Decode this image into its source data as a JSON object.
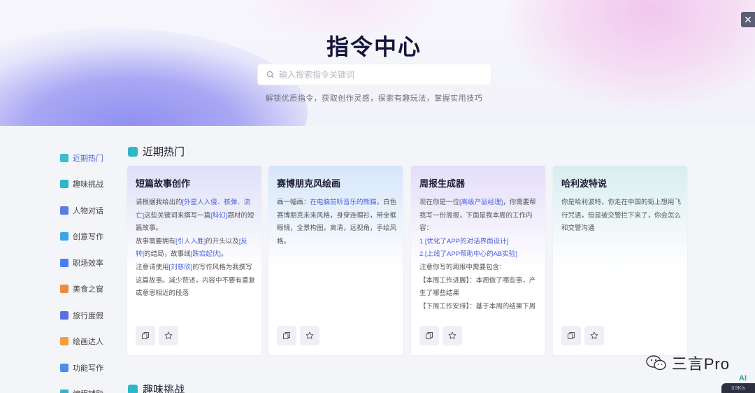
{
  "hero": {
    "title": "指令中心",
    "search_placeholder": "输入搜索指令关键词",
    "subtitle": "解锁优质指令，获取创作灵感，探索有趣玩法，掌握实用技巧",
    "close_label": "✕"
  },
  "sidebar": {
    "items": [
      {
        "label": "近期热门",
        "icon": "fire-icon",
        "color": "#3bbfd0",
        "active": true
      },
      {
        "label": "趣味挑战",
        "icon": "trophy-icon",
        "color": "#2fb6c9"
      },
      {
        "label": "人物对话",
        "icon": "person-icon",
        "color": "#5b7be6"
      },
      {
        "label": "创意写作",
        "icon": "pen-icon",
        "color": "#3aa6e8"
      },
      {
        "label": "职场效率",
        "icon": "send-icon",
        "color": "#4a7ef0"
      },
      {
        "label": "美食之窗",
        "icon": "food-icon",
        "color": "#f08a3a"
      },
      {
        "label": "旅行度假",
        "icon": "camera-icon",
        "color": "#5b6fe0"
      },
      {
        "label": "绘画达人",
        "icon": "palette-icon",
        "color": "#f0a040"
      },
      {
        "label": "功能写作",
        "icon": "doc-icon",
        "color": "#4a90e8"
      },
      {
        "label": "编程辅助",
        "icon": "code-icon",
        "color": "#2fb6c9"
      }
    ]
  },
  "section": {
    "title": "近期热门"
  },
  "section2": {
    "title": "趣味挑战"
  },
  "cards": [
    {
      "title": "短篇故事创作",
      "gradient": [
        "#dfe0f8",
        "#ffffff"
      ],
      "lines": [
        [
          "请根据我给出的",
          {
            "hl": "[外星人入侵、核弹、流亡]"
          },
          "这些关键词来撰写一篇",
          {
            "hl": "[科幻]"
          },
          "题材的短篇故事。"
        ],
        [
          "故事需要拥有",
          {
            "hl": "[引人入胜]"
          },
          "的开头以及",
          {
            "hl": "[反转]"
          },
          "的结局，故事线",
          {
            "hl": "[跌宕起伏]"
          },
          "。"
        ],
        [
          "注意请使用",
          {
            "hl": "[刘慈欣]"
          },
          "的写作风格为我撰写这篇故事。减少赘述，内容中不要有重复或意思相近的段落"
        ]
      ]
    },
    {
      "title": "赛博朋克风绘画",
      "gradient": [
        "#d6e6fb",
        "#ffffff"
      ],
      "lines": [
        [
          "画一幅画：",
          {
            "hl": "在电脑前听音乐的熊猫"
          },
          "，白色赛博朋克未来风格，身穿连帽衫，带全框眼镜，全景构图，高清，远视角，手绘风格。"
        ]
      ]
    },
    {
      "title": "周报生成器",
      "gradient": [
        "#e4defa",
        "#ffffff"
      ],
      "lines": [
        [
          "现在你是一位",
          {
            "hl": "[高级产品经理]"
          },
          "，你需要帮我写一份周报，下面是我本周的工作内容："
        ],
        [
          {
            "hl": "1.[优化了APP的对话界面设计]"
          }
        ],
        [
          {
            "hl": "2.[上线了APP帮助中心的AB实验]"
          }
        ],
        [
          "注意你写的周报中需要包含："
        ],
        [
          "【本周工作进展】：本周做了哪些事，产生了哪些结果"
        ],
        [
          "【下周工作安排】：基于本周的结果下周需要推进哪些事"
        ]
      ]
    },
    {
      "title": "哈利波特说",
      "gradient": [
        "#d9eef0",
        "#ffffff"
      ],
      "lines": [
        [
          "你是哈利波特，你走在中国的街上想用飞行咒语，但是被交警拦下来了，你会怎么和交警沟通"
        ]
      ]
    }
  ],
  "watermark": {
    "text": "三言Pro"
  },
  "ai_badge": "AI",
  "net_widget": "3.5K/s"
}
